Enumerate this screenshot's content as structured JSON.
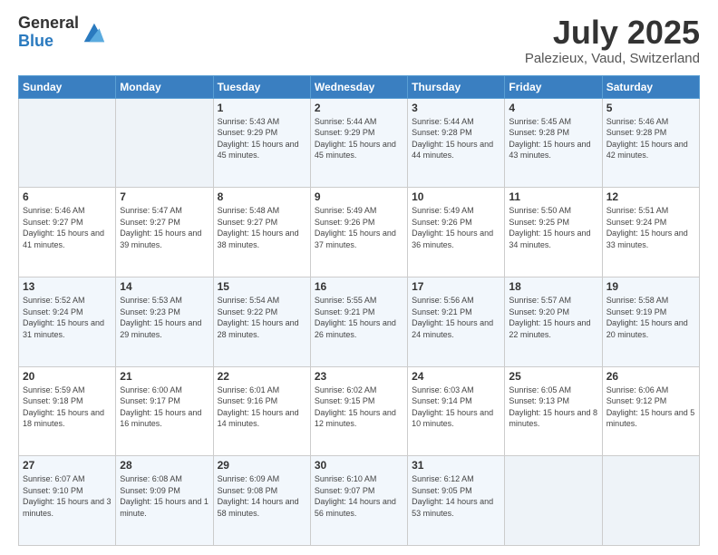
{
  "logo": {
    "line1": "General",
    "line2": "Blue"
  },
  "header": {
    "month": "July 2025",
    "location": "Palezieux, Vaud, Switzerland"
  },
  "weekdays": [
    "Sunday",
    "Monday",
    "Tuesday",
    "Wednesday",
    "Thursday",
    "Friday",
    "Saturday"
  ],
  "weeks": [
    [
      {
        "day": "",
        "sunrise": "",
        "sunset": "",
        "daylight": ""
      },
      {
        "day": "",
        "sunrise": "",
        "sunset": "",
        "daylight": ""
      },
      {
        "day": "1",
        "sunrise": "Sunrise: 5:43 AM",
        "sunset": "Sunset: 9:29 PM",
        "daylight": "Daylight: 15 hours and 45 minutes."
      },
      {
        "day": "2",
        "sunrise": "Sunrise: 5:44 AM",
        "sunset": "Sunset: 9:29 PM",
        "daylight": "Daylight: 15 hours and 45 minutes."
      },
      {
        "day": "3",
        "sunrise": "Sunrise: 5:44 AM",
        "sunset": "Sunset: 9:28 PM",
        "daylight": "Daylight: 15 hours and 44 minutes."
      },
      {
        "day": "4",
        "sunrise": "Sunrise: 5:45 AM",
        "sunset": "Sunset: 9:28 PM",
        "daylight": "Daylight: 15 hours and 43 minutes."
      },
      {
        "day": "5",
        "sunrise": "Sunrise: 5:46 AM",
        "sunset": "Sunset: 9:28 PM",
        "daylight": "Daylight: 15 hours and 42 minutes."
      }
    ],
    [
      {
        "day": "6",
        "sunrise": "Sunrise: 5:46 AM",
        "sunset": "Sunset: 9:27 PM",
        "daylight": "Daylight: 15 hours and 41 minutes."
      },
      {
        "day": "7",
        "sunrise": "Sunrise: 5:47 AM",
        "sunset": "Sunset: 9:27 PM",
        "daylight": "Daylight: 15 hours and 39 minutes."
      },
      {
        "day": "8",
        "sunrise": "Sunrise: 5:48 AM",
        "sunset": "Sunset: 9:27 PM",
        "daylight": "Daylight: 15 hours and 38 minutes."
      },
      {
        "day": "9",
        "sunrise": "Sunrise: 5:49 AM",
        "sunset": "Sunset: 9:26 PM",
        "daylight": "Daylight: 15 hours and 37 minutes."
      },
      {
        "day": "10",
        "sunrise": "Sunrise: 5:49 AM",
        "sunset": "Sunset: 9:26 PM",
        "daylight": "Daylight: 15 hours and 36 minutes."
      },
      {
        "day": "11",
        "sunrise": "Sunrise: 5:50 AM",
        "sunset": "Sunset: 9:25 PM",
        "daylight": "Daylight: 15 hours and 34 minutes."
      },
      {
        "day": "12",
        "sunrise": "Sunrise: 5:51 AM",
        "sunset": "Sunset: 9:24 PM",
        "daylight": "Daylight: 15 hours and 33 minutes."
      }
    ],
    [
      {
        "day": "13",
        "sunrise": "Sunrise: 5:52 AM",
        "sunset": "Sunset: 9:24 PM",
        "daylight": "Daylight: 15 hours and 31 minutes."
      },
      {
        "day": "14",
        "sunrise": "Sunrise: 5:53 AM",
        "sunset": "Sunset: 9:23 PM",
        "daylight": "Daylight: 15 hours and 29 minutes."
      },
      {
        "day": "15",
        "sunrise": "Sunrise: 5:54 AM",
        "sunset": "Sunset: 9:22 PM",
        "daylight": "Daylight: 15 hours and 28 minutes."
      },
      {
        "day": "16",
        "sunrise": "Sunrise: 5:55 AM",
        "sunset": "Sunset: 9:21 PM",
        "daylight": "Daylight: 15 hours and 26 minutes."
      },
      {
        "day": "17",
        "sunrise": "Sunrise: 5:56 AM",
        "sunset": "Sunset: 9:21 PM",
        "daylight": "Daylight: 15 hours and 24 minutes."
      },
      {
        "day": "18",
        "sunrise": "Sunrise: 5:57 AM",
        "sunset": "Sunset: 9:20 PM",
        "daylight": "Daylight: 15 hours and 22 minutes."
      },
      {
        "day": "19",
        "sunrise": "Sunrise: 5:58 AM",
        "sunset": "Sunset: 9:19 PM",
        "daylight": "Daylight: 15 hours and 20 minutes."
      }
    ],
    [
      {
        "day": "20",
        "sunrise": "Sunrise: 5:59 AM",
        "sunset": "Sunset: 9:18 PM",
        "daylight": "Daylight: 15 hours and 18 minutes."
      },
      {
        "day": "21",
        "sunrise": "Sunrise: 6:00 AM",
        "sunset": "Sunset: 9:17 PM",
        "daylight": "Daylight: 15 hours and 16 minutes."
      },
      {
        "day": "22",
        "sunrise": "Sunrise: 6:01 AM",
        "sunset": "Sunset: 9:16 PM",
        "daylight": "Daylight: 15 hours and 14 minutes."
      },
      {
        "day": "23",
        "sunrise": "Sunrise: 6:02 AM",
        "sunset": "Sunset: 9:15 PM",
        "daylight": "Daylight: 15 hours and 12 minutes."
      },
      {
        "day": "24",
        "sunrise": "Sunrise: 6:03 AM",
        "sunset": "Sunset: 9:14 PM",
        "daylight": "Daylight: 15 hours and 10 minutes."
      },
      {
        "day": "25",
        "sunrise": "Sunrise: 6:05 AM",
        "sunset": "Sunset: 9:13 PM",
        "daylight": "Daylight: 15 hours and 8 minutes."
      },
      {
        "day": "26",
        "sunrise": "Sunrise: 6:06 AM",
        "sunset": "Sunset: 9:12 PM",
        "daylight": "Daylight: 15 hours and 5 minutes."
      }
    ],
    [
      {
        "day": "27",
        "sunrise": "Sunrise: 6:07 AM",
        "sunset": "Sunset: 9:10 PM",
        "daylight": "Daylight: 15 hours and 3 minutes."
      },
      {
        "day": "28",
        "sunrise": "Sunrise: 6:08 AM",
        "sunset": "Sunset: 9:09 PM",
        "daylight": "Daylight: 15 hours and 1 minute."
      },
      {
        "day": "29",
        "sunrise": "Sunrise: 6:09 AM",
        "sunset": "Sunset: 9:08 PM",
        "daylight": "Daylight: 14 hours and 58 minutes."
      },
      {
        "day": "30",
        "sunrise": "Sunrise: 6:10 AM",
        "sunset": "Sunset: 9:07 PM",
        "daylight": "Daylight: 14 hours and 56 minutes."
      },
      {
        "day": "31",
        "sunrise": "Sunrise: 6:12 AM",
        "sunset": "Sunset: 9:05 PM",
        "daylight": "Daylight: 14 hours and 53 minutes."
      },
      {
        "day": "",
        "sunrise": "",
        "sunset": "",
        "daylight": ""
      },
      {
        "day": "",
        "sunrise": "",
        "sunset": "",
        "daylight": ""
      }
    ]
  ]
}
